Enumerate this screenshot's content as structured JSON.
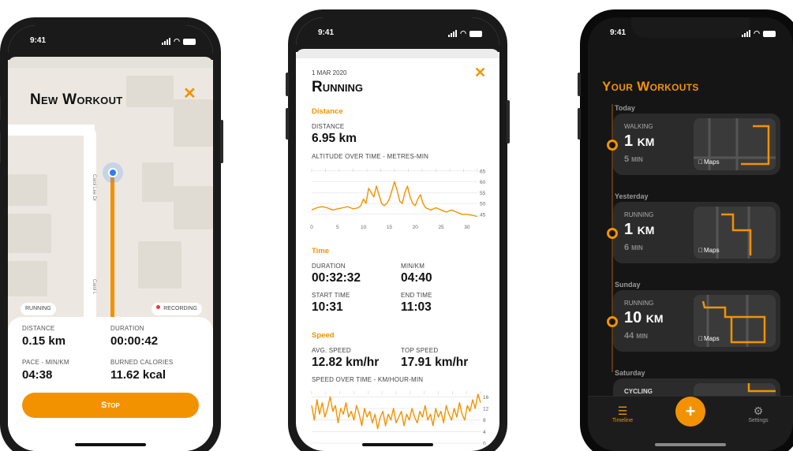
{
  "colors": {
    "accent": "#f39200",
    "dark_bg": "#151515",
    "card_bg": "#2b2b2b",
    "map_bg": "#ece8e1"
  },
  "phone1": {
    "status_time": "9:41",
    "title": "New Workout",
    "road_label_1": "Carol Lee Dr",
    "road_label_2": "Carol L",
    "activity_pill": "RUNNING",
    "recording_pill": "RECORDING",
    "stats": {
      "distance_label": "DISTANCE",
      "distance_value": "0.15 km",
      "duration_label": "DURATION",
      "duration_value": "00:00:42",
      "pace_label": "PACE - MIN/KM",
      "pace_value": "04:38",
      "calories_label": "BURNED CALORIES",
      "calories_value": "11.62 kcal"
    },
    "stop_button": "Stop"
  },
  "phone2": {
    "status_time": "9:41",
    "date": "1 MAR 2020",
    "title": "Running",
    "distance_section": "Distance",
    "distance_label": "DISTANCE",
    "distance_value": "6.95 km",
    "altitude_chart_label": "ALTITUDE OVER TIME - METRES-MIN",
    "time_section": "Time",
    "duration_label": "DURATION",
    "duration_value": "00:32:32",
    "pace_label": "MIN/KM",
    "pace_value": "04:40",
    "start_label": "START TIME",
    "start_value": "10:31",
    "end_label": "END TIME",
    "end_value": "11:03",
    "speed_section": "Speed",
    "avg_speed_label": "AVG. SPEED",
    "avg_speed_value": "12.82 km/hr",
    "top_speed_label": "TOP SPEED",
    "top_speed_value": "17.91 km/hr",
    "speed_chart_label": "SPEED OVER TIME - KM/HOUR-MIN"
  },
  "phone3": {
    "status_time": "9:41",
    "title": "Your Workouts",
    "days": [
      "Today",
      "Yesterday",
      "Sunday",
      "Saturday"
    ],
    "workouts": [
      {
        "type": "WALKING",
        "distance": "1 km",
        "duration": "5 min",
        "maps": "Maps"
      },
      {
        "type": "RUNNING",
        "distance": "1 km",
        "duration": "6 min",
        "maps": "Maps"
      },
      {
        "type": "RUNNING",
        "distance": "10 km",
        "duration": "44 min",
        "maps": "Maps"
      },
      {
        "type": "CYCLING"
      }
    ],
    "tabs": {
      "timeline": "Timeline",
      "settings": "Settings",
      "add": "+"
    }
  },
  "chart_data": [
    {
      "type": "line",
      "title": "ALTITUDE OVER TIME - METRES-MIN",
      "x_ticks": [
        0,
        5,
        10,
        15,
        20,
        25,
        30
      ],
      "y_ticks": [
        45,
        50,
        55,
        60,
        65
      ],
      "xlim": [
        0,
        32
      ],
      "ylim": [
        42,
        66
      ],
      "series": [
        {
          "x": [
            0,
            1,
            2,
            3,
            4,
            5,
            6,
            7,
            8,
            9,
            9.5,
            10,
            10.5,
            11,
            11.5,
            12,
            12.5,
            13,
            13.5,
            14,
            14.5,
            15,
            15.5,
            16,
            16.5,
            17,
            17.5,
            18,
            18.5,
            19,
            19.5,
            20,
            20.5,
            21,
            21.5,
            22,
            23,
            24,
            25,
            26,
            27,
            28,
            29,
            30,
            31,
            32
          ],
          "y": [
            47,
            48,
            48.5,
            48,
            47,
            47.5,
            48,
            48.5,
            47.5,
            48,
            49,
            52,
            50,
            57,
            55,
            53,
            58,
            54,
            50,
            49,
            50,
            52,
            56,
            60,
            56,
            51,
            50,
            55,
            58,
            53,
            50,
            49,
            52,
            54,
            50,
            48,
            47,
            48,
            47,
            46,
            47,
            46,
            45,
            45,
            44.5,
            44
          ]
        }
      ]
    },
    {
      "type": "line",
      "title": "SPEED OVER TIME - KM/HOUR-MIN",
      "y_ticks": [
        0,
        4,
        8,
        12,
        16
      ],
      "ylim": [
        0,
        18
      ],
      "xlim": [
        0,
        32
      ],
      "series": [
        {
          "x": [
            0,
            0.5,
            1,
            1.5,
            2,
            2.5,
            3,
            3.5,
            4,
            4.5,
            5,
            5.5,
            6,
            6.5,
            7,
            7.5,
            8,
            8.5,
            9,
            9.5,
            10,
            10.5,
            11,
            11.5,
            12,
            12.5,
            13,
            13.5,
            14,
            14.5,
            15,
            15.5,
            16,
            16.5,
            17,
            17.5,
            18,
            18.5,
            19,
            19.5,
            20,
            20.5,
            21,
            21.5,
            22,
            22.5,
            23,
            23.5,
            24,
            24.5,
            25,
            25.5,
            26,
            26.5,
            27,
            27.5,
            28,
            28.5,
            29,
            29.5,
            30,
            30.5,
            31,
            31.5,
            32
          ],
          "y": [
            13,
            8,
            15,
            10,
            14,
            9,
            12,
            16,
            11,
            13,
            7,
            12,
            10,
            14,
            9,
            11,
            8,
            13,
            10,
            6,
            12,
            9,
            11,
            7,
            10,
            5,
            9,
            11,
            6,
            10,
            8,
            12,
            7,
            9,
            11,
            6,
            10,
            8,
            12,
            9,
            7,
            11,
            9,
            13,
            8,
            10,
            6,
            12,
            9,
            11,
            7,
            13,
            10,
            8,
            12,
            9,
            14,
            10,
            8,
            13,
            11,
            15,
            12,
            17,
            14
          ]
        }
      ]
    }
  ]
}
